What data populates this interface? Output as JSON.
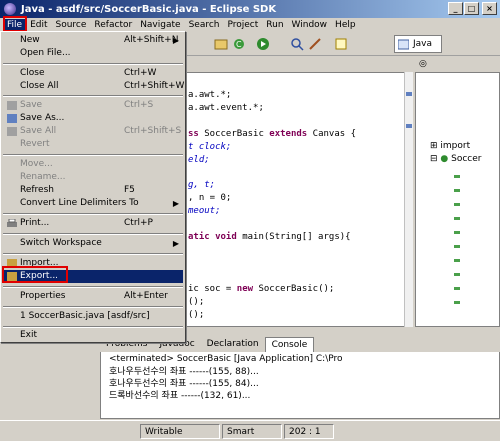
{
  "window": {
    "title": "Java - asdf/src/SoccerBasic.java - Eclipse SDK",
    "minimize": "_",
    "maximize": "□",
    "close": "×"
  },
  "menubar": [
    "File",
    "Edit",
    "Source",
    "Refactor",
    "Navigate",
    "Search",
    "Project",
    "Run",
    "Window",
    "Help"
  ],
  "toolbar": {
    "perspective_label": "Java"
  },
  "file_menu": {
    "new": {
      "label": "New",
      "shortcut": "Alt+Shift+N"
    },
    "open_file": {
      "label": "Open File..."
    },
    "close": {
      "label": "Close",
      "shortcut": "Ctrl+W"
    },
    "close_all": {
      "label": "Close All",
      "shortcut": "Ctrl+Shift+W"
    },
    "save": {
      "label": "Save",
      "shortcut": "Ctrl+S"
    },
    "save_as": {
      "label": "Save As..."
    },
    "save_all": {
      "label": "Save All",
      "shortcut": "Ctrl+Shift+S"
    },
    "revert": {
      "label": "Revert"
    },
    "move": {
      "label": "Move..."
    },
    "rename": {
      "label": "Rename..."
    },
    "refresh": {
      "label": "Refresh",
      "shortcut": "F5"
    },
    "convert": {
      "label": "Convert Line Delimiters To"
    },
    "print": {
      "label": "Print...",
      "shortcut": "Ctrl+P"
    },
    "switch_workspace": {
      "label": "Switch Workspace"
    },
    "import": {
      "label": "Import..."
    },
    "export": {
      "label": "Export..."
    },
    "properties": {
      "label": "Properties",
      "shortcut": "Alt+Enter"
    },
    "recent": {
      "label": "1 SoccerBasic.java  [asdf/src]"
    },
    "exit": {
      "label": "Exit"
    }
  },
  "editor": {
    "lines": [
      "a.awt.*;",
      "a.awt.event.*;",
      "",
      "ss SoccerBasic extends Canvas {",
      "t clock;",
      "eld;",
      "",
      "g, t;",
      ", n = 0;",
      "meout;",
      "",
      "atic void main(String[] args){",
      "",
      "",
      "",
      "ic soc = new SoccerBasic();",
      "();",
      "();"
    ]
  },
  "outline": {
    "items": [
      "import",
      "Soccer"
    ]
  },
  "console": {
    "tabs": [
      "Problems",
      "Javadoc",
      "Declaration",
      "Console"
    ],
    "header": "<terminated> SoccerBasic [Java Application] C:\\Pro",
    "lines": [
      "호나우두선수의 좌표 ------(155, 88)...",
      "호나우두선수의 좌표 ------(155, 84)...",
      "드록바선수의 좌표 ------(132, 61)..."
    ]
  },
  "status": {
    "mode": "Writable",
    "insert": "Smart Insert",
    "position": "202 : 1"
  }
}
